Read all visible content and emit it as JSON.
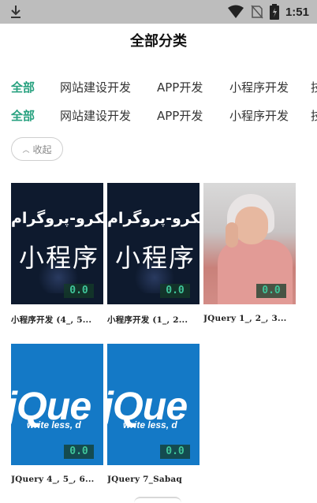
{
  "status_bar": {
    "time": "1:51",
    "icons": [
      "download-icon",
      "wifi-icon",
      "no-sim-icon",
      "battery-icon"
    ]
  },
  "page": {
    "title": "全部分类"
  },
  "tabs_row1": [
    "全部",
    "网站建设开发",
    "APP开发",
    "小程序开发",
    "技"
  ],
  "tabs_row2": [
    "全部",
    "网站建设开发",
    "APP开发",
    "小程序开发",
    "技"
  ],
  "collapse_button": {
    "label": "收起"
  },
  "thumb_text": {
    "arabic": "میکرو-پروگرام",
    "mini_program": "小程序",
    "jquery_logo": "jQue",
    "jquery_tagline": "write less, d"
  },
  "cards": [
    {
      "caption": "小程序开发 (4_, 5...",
      "score": "0.0"
    },
    {
      "caption": "小程序开发 (1_, 2...",
      "score": "0.0"
    },
    {
      "caption": "JQuery 1_, 2_, 3...",
      "score": "0.0"
    },
    {
      "caption": "JQuery 4_, 5_, 6...",
      "score": "0.0"
    },
    {
      "caption": "JQuery 7_Sabaq",
      "score": "0.0"
    }
  ],
  "colors": {
    "accent": "#27a17f",
    "jquery_blue": "#1479c6",
    "status_bar": "#bdbdbd"
  }
}
